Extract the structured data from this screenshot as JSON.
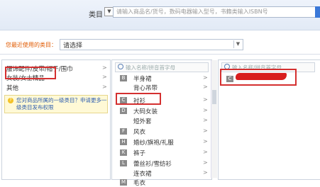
{
  "header": {
    "category_label": "类目",
    "category_arrow": "▼",
    "search_placeholder": "请输入商品名/货号，数码电器输入型号，书籍类输入ISBN号"
  },
  "recent": {
    "label": "您最近使用的类目：",
    "value": "请选择",
    "arrow": "▼"
  },
  "col1": {
    "items": [
      {
        "label": "服饰配件/皮带/帽子/围巾",
        "arrow": ">"
      },
      {
        "label": "女装/女士精品",
        "arrow": ">"
      },
      {
        "label": "其他",
        "arrow": ">"
      }
    ],
    "tip_icon": "?",
    "tip": "您对商品所属的一级类目？申请更多一级类目发布权限"
  },
  "col2": {
    "search_placeholder": "输入名称/拼音首字母",
    "items": [
      {
        "letter": "B",
        "label": "半身裙",
        "arrow": ">"
      },
      {
        "letter": "",
        "label": "背心吊带",
        "arrow": ">"
      },
      {
        "letter": "C",
        "label": "衬衫",
        "arrow": ">"
      },
      {
        "letter": "D",
        "label": "大码女装",
        "arrow": ">"
      },
      {
        "letter": "",
        "label": "短外套",
        "arrow": ">"
      },
      {
        "letter": "F",
        "label": "风衣",
        "arrow": ">"
      },
      {
        "letter": "H",
        "label": "婚纱/旗袍/礼服",
        "arrow": ">"
      },
      {
        "letter": "K",
        "label": "裤子",
        "arrow": ">"
      },
      {
        "letter": "L",
        "label": "蕾丝衫/雪纺衫",
        "arrow": ">"
      },
      {
        "letter": "",
        "label": "连衣裙",
        "arrow": ">"
      },
      {
        "letter": "M",
        "label": "毛衣",
        "arrow": ">"
      }
    ]
  },
  "col3": {
    "search_placeholder": "输入名称/拼音首字母",
    "items": [
      {
        "letter": "C"
      }
    ]
  }
}
